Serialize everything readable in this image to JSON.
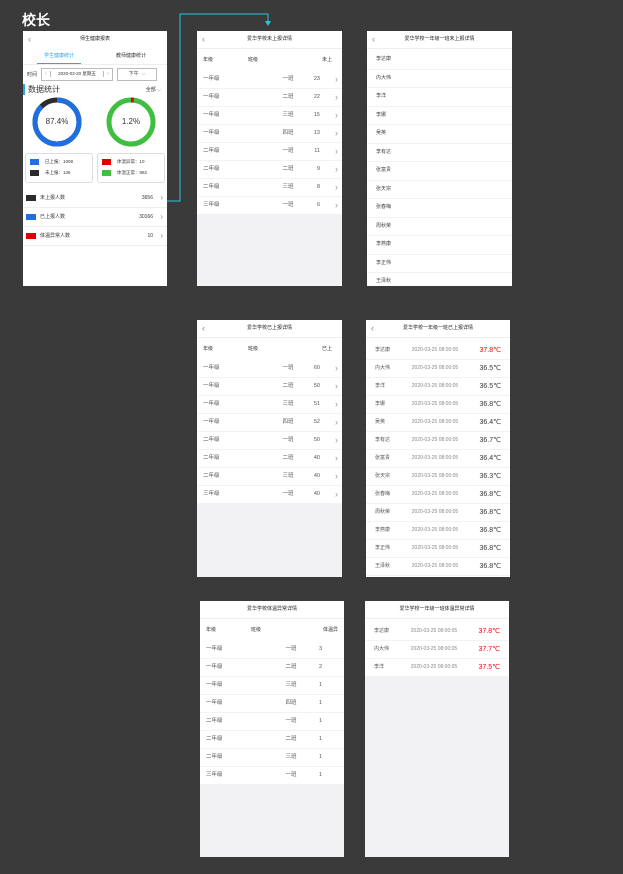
{
  "role_title": "校长",
  "dashboard": {
    "nav_title": "师生健康报表",
    "tabs": [
      "学生健康统计",
      "教师健康统计"
    ],
    "time_label": "时间",
    "date_value": "2020-03-20 星期五",
    "period_value": "下午",
    "section_title": "数据统计",
    "filter_value": "全部",
    "ring1_pct": "87.4%",
    "ring1_value": 87.4,
    "ring2_pct": "1.2%",
    "ring2_value": 1.2,
    "legend1": [
      {
        "label": "已上报：1008",
        "color": "#1f6fe0"
      },
      {
        "label": "未上报：136",
        "color": "#2b2b2b"
      }
    ],
    "legend2": [
      {
        "label": "体温异常：10",
        "color": "#e00000"
      },
      {
        "label": "体温正常：862",
        "color": "#3fbf3f"
      }
    ],
    "stats": [
      {
        "label": "未上报人数",
        "value": "3656",
        "color": "#2b2b2b"
      },
      {
        "label": "已上报人数",
        "value": "30166",
        "color": "#1f6fe0"
      },
      {
        "label": "体温异常人数",
        "value": "10",
        "color": "#e00000"
      }
    ],
    "colors": {
      "accent": "#2aa7e6",
      "blue": "#1f6fe0",
      "green": "#3fbf3f",
      "red": "#e00000",
      "dark": "#2b2b2b"
    }
  },
  "unreported": {
    "nav_title": "爱华学校未上报详情",
    "headers": [
      "年级",
      "班级",
      "未上报人数"
    ],
    "rows": [
      [
        "一年级",
        "一班",
        "23"
      ],
      [
        "一年级",
        "二班",
        "22"
      ],
      [
        "一年级",
        "三班",
        "15"
      ],
      [
        "一年级",
        "四班",
        "13"
      ],
      [
        "二年级",
        "一班",
        "11"
      ],
      [
        "二年级",
        "二班",
        "9"
      ],
      [
        "二年级",
        "三班",
        "8"
      ],
      [
        "三年级",
        "一班",
        "6"
      ]
    ]
  },
  "unreported_names": {
    "nav_title": "爱华学校一年级一班未上报详情",
    "names": [
      "李达康",
      "内大伟",
      "李洋",
      "李娜",
      "吴英",
      "李有达",
      "张富贵",
      "张天宗",
      "张春梅",
      "周秋荣",
      "李燕康",
      "李正伟",
      "王泽秋"
    ]
  },
  "reported": {
    "nav_title": "爱华学校已上报详情",
    "headers": [
      "年级",
      "班级",
      "已上报人数"
    ],
    "rows": [
      [
        "一年级",
        "一班",
        "60"
      ],
      [
        "一年级",
        "二班",
        "50"
      ],
      [
        "一年级",
        "三班",
        "51"
      ],
      [
        "一年级",
        "四班",
        "52"
      ],
      [
        "二年级",
        "一班",
        "50"
      ],
      [
        "二年级",
        "二班",
        "40"
      ],
      [
        "二年级",
        "三班",
        "40"
      ],
      [
        "三年级",
        "一班",
        "40"
      ]
    ]
  },
  "reported_detail": {
    "nav_title": "爱华学校一年级一班已上报详情",
    "rows": [
      {
        "name": "李达康",
        "time": "2020-03-25 08:00:05",
        "temp": "37.8℃",
        "abnormal": true
      },
      {
        "name": "内大伟",
        "time": "2020-03-25 08:00:05",
        "temp": "36.5℃",
        "abnormal": false
      },
      {
        "name": "李洋",
        "time": "2020-03-25 08:00:05",
        "temp": "36.5℃",
        "abnormal": false
      },
      {
        "name": "李娜",
        "time": "2020-03-25 08:00:05",
        "temp": "36.8℃",
        "abnormal": false
      },
      {
        "name": "吴英",
        "time": "2020-03-25 08:00:05",
        "temp": "36.4℃",
        "abnormal": false
      },
      {
        "name": "李有达",
        "time": "2020-03-25 08:00:05",
        "temp": "36.7℃",
        "abnormal": false
      },
      {
        "name": "张富贵",
        "time": "2020-03-25 08:00:05",
        "temp": "36.4℃",
        "abnormal": false
      },
      {
        "name": "张天宗",
        "time": "2020-03-25 08:00:05",
        "temp": "36.3℃",
        "abnormal": false
      },
      {
        "name": "张春梅",
        "time": "2020-03-25 08:00:05",
        "temp": "36.8℃",
        "abnormal": false
      },
      {
        "name": "周秋荣",
        "time": "2020-03-25 08:00:05",
        "temp": "36.8℃",
        "abnormal": false
      },
      {
        "name": "李燕康",
        "time": "2020-03-25 08:00:05",
        "temp": "36.8℃",
        "abnormal": false
      },
      {
        "name": "李正伟",
        "time": "2020-03-25 08:00:05",
        "temp": "36.8℃",
        "abnormal": false
      },
      {
        "name": "王泽秋",
        "time": "2020-03-25 08:00:05",
        "temp": "36.8℃",
        "abnormal": false
      }
    ]
  },
  "abnormal": {
    "nav_title": "爱华学校体温异常详情",
    "headers": [
      "年级",
      "班级",
      "体温异常人数"
    ],
    "rows": [
      [
        "一年级",
        "一班",
        "3"
      ],
      [
        "一年级",
        "二班",
        "2"
      ],
      [
        "一年级",
        "三班",
        "1"
      ],
      [
        "一年级",
        "四班",
        "1"
      ],
      [
        "二年级",
        "一班",
        "1"
      ],
      [
        "二年级",
        "二班",
        "1"
      ],
      [
        "二年级",
        "三班",
        "1"
      ],
      [
        "三年级",
        "一班",
        "1"
      ]
    ]
  },
  "abnormal_detail": {
    "nav_title": "爱华学校一年级一班体温异常详情",
    "rows": [
      {
        "name": "李达康",
        "time": "2020-03-25 08:00:05",
        "temp": "37.8℃"
      },
      {
        "name": "内大伟",
        "time": "2020-03-25 08:00:05",
        "temp": "37.7℃"
      },
      {
        "name": "李洋",
        "time": "2020-03-25 08:00:05",
        "temp": "37.5℃"
      }
    ]
  }
}
